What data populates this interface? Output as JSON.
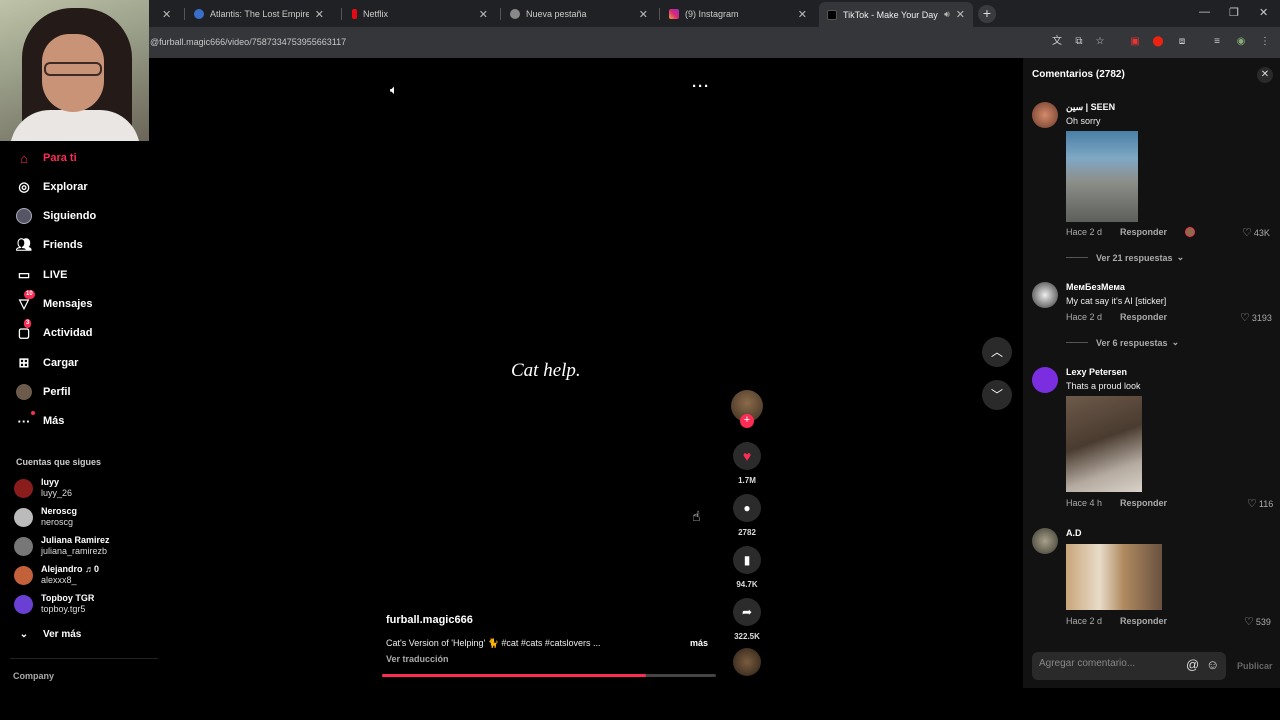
{
  "browser": {
    "tabs": [
      {
        "title": "",
        "color": "#555"
      },
      {
        "title": "Atlantis: The Lost Empire | Dis",
        "color": "#3b6ec9"
      },
      {
        "title": "Netflix",
        "color": "#e50914"
      },
      {
        "title": "Nueva pestaña",
        "color": "#777"
      },
      {
        "title": "(9) Instagram",
        "color": "#d62976"
      },
      {
        "title": "TikTok - Make Your Day",
        "color": "#111"
      }
    ],
    "new_tab": "+",
    "url": "@furball.magic666/video/7587334753955663117",
    "window_controls": {
      "minimize": "—",
      "restore": "❐",
      "close": "✕"
    }
  },
  "nav": {
    "items": [
      {
        "label": "Para ti",
        "icon": "home-icon"
      },
      {
        "label": "Explorar",
        "icon": "compass-icon"
      },
      {
        "label": "Siguiendo",
        "icon": "following-icon"
      },
      {
        "label": "Friends",
        "icon": "friends-icon"
      },
      {
        "label": "LIVE",
        "icon": "live-icon"
      },
      {
        "label": "Mensajes",
        "icon": "messages-icon",
        "badge": "10"
      },
      {
        "label": "Actividad",
        "icon": "activity-icon",
        "badge": "3"
      },
      {
        "label": "Cargar",
        "icon": "upload-icon"
      },
      {
        "label": "Perfil",
        "icon": "profile-icon"
      },
      {
        "label": "Más",
        "icon": "more-icon"
      }
    ],
    "following_title": "Cuentas que sigues",
    "following": [
      {
        "name": "luyy",
        "handle": "luyy_26",
        "color": "#8a1c1c"
      },
      {
        "name": "Neroscg",
        "handle": "neroscg",
        "color": "#bbbbbb"
      },
      {
        "name": "Juliana Ramirez",
        "handle": "juliana_ramirezb",
        "color": "#777777"
      },
      {
        "name": "Alejandro ♬0",
        "handle": "alexxx8_",
        "color": "#c2613a"
      },
      {
        "name": "Topboy TGR",
        "handle": "topboy.tgr5",
        "color": "#6a3fd4"
      }
    ],
    "see_more": "Ver más",
    "company": "Company"
  },
  "video": {
    "overlay_text": "Cat help.",
    "author": "furball.magic666",
    "description": "Cat's Version of 'Helping' 🐈 #cat #cats #catslovers ...",
    "more": "más",
    "translate": "Ver traducción",
    "progress": 0.79,
    "likes": "1.7M",
    "comments": "2782",
    "saves": "94.7K",
    "shares": "322.5K",
    "accent": "#fe2c55"
  },
  "comments": {
    "title": "Comentarios (2782)",
    "input_placeholder": "Agregar comentario...",
    "publish": "Publicar",
    "reply_label": "Responder",
    "items": [
      {
        "user": "سين | SEEN",
        "text": "Oh sorry",
        "time": "Hace 2 d",
        "likes": "43K",
        "replies": "Ver 21 respuestas"
      },
      {
        "user": "МемБезМема",
        "text": "My cat say it's AI [sticker]",
        "time": "Hace 2 d",
        "likes": "3193",
        "replies": "Ver 6 respuestas"
      },
      {
        "user": "Lexy Petersen",
        "text": "Thats a proud look",
        "time": "Hace 4 h",
        "likes": "116"
      },
      {
        "user": "A.D",
        "text": "",
        "time": "Hace 2 d",
        "likes": "539"
      }
    ]
  }
}
